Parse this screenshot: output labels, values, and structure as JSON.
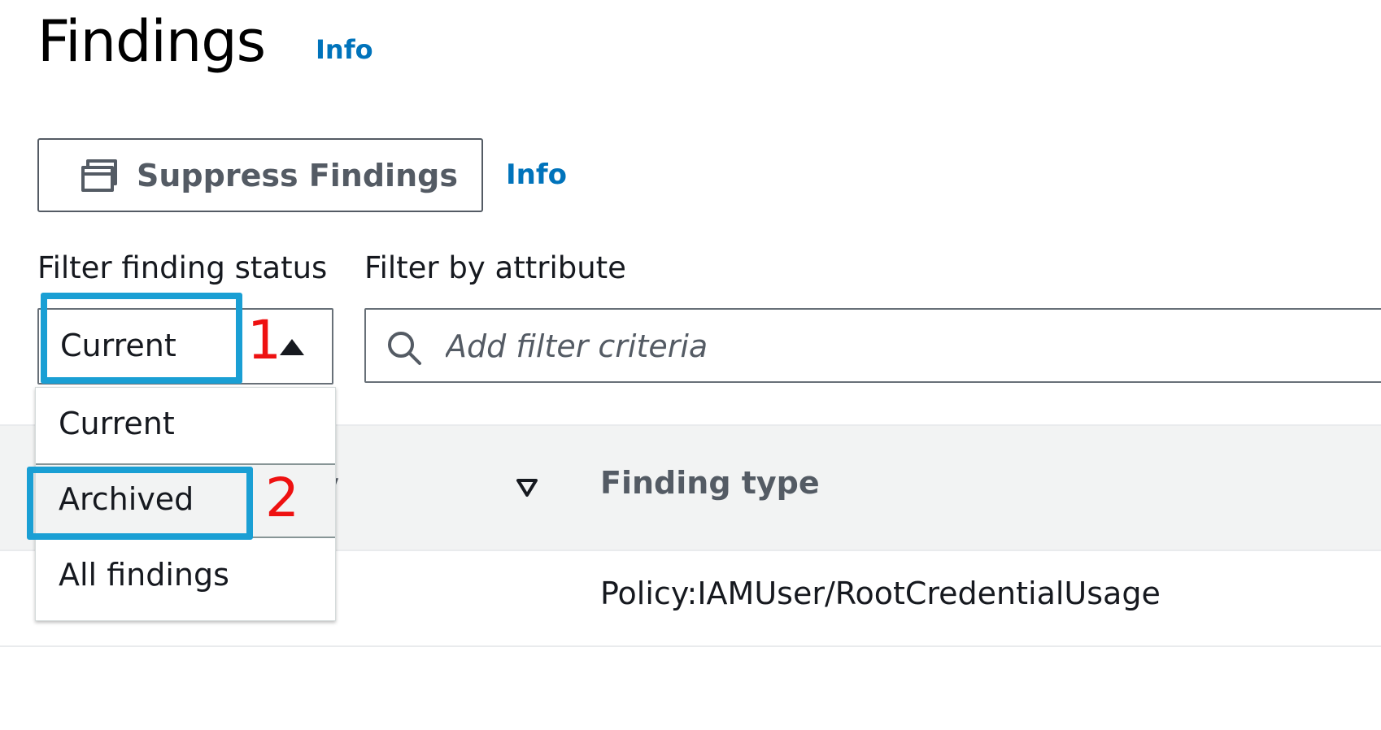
{
  "header": {
    "title": "Findings",
    "info_label": "Info"
  },
  "toolbar": {
    "suppress_label": "Suppress Findings",
    "info_label": "Info"
  },
  "filters": {
    "status_label": "Filter finding status",
    "attribute_label": "Filter by attribute",
    "status_value": "Current",
    "search_placeholder": "Add filter criteria",
    "status_options": [
      "Current",
      "Archived",
      "All findings"
    ],
    "highlighted_option": "Archived"
  },
  "table": {
    "partial_header": "y",
    "finding_type_header": "Finding type",
    "rows": [
      {
        "finding_type": "Policy:IAMUser/RootCredentialUsage"
      }
    ]
  },
  "annotations": {
    "step1": "1",
    "step2": "2",
    "highlight_color": "#1a9fd4",
    "number_color": "#ee1111"
  },
  "colors": {
    "link": "#0073bb",
    "header_band": "#f2f3f3"
  }
}
